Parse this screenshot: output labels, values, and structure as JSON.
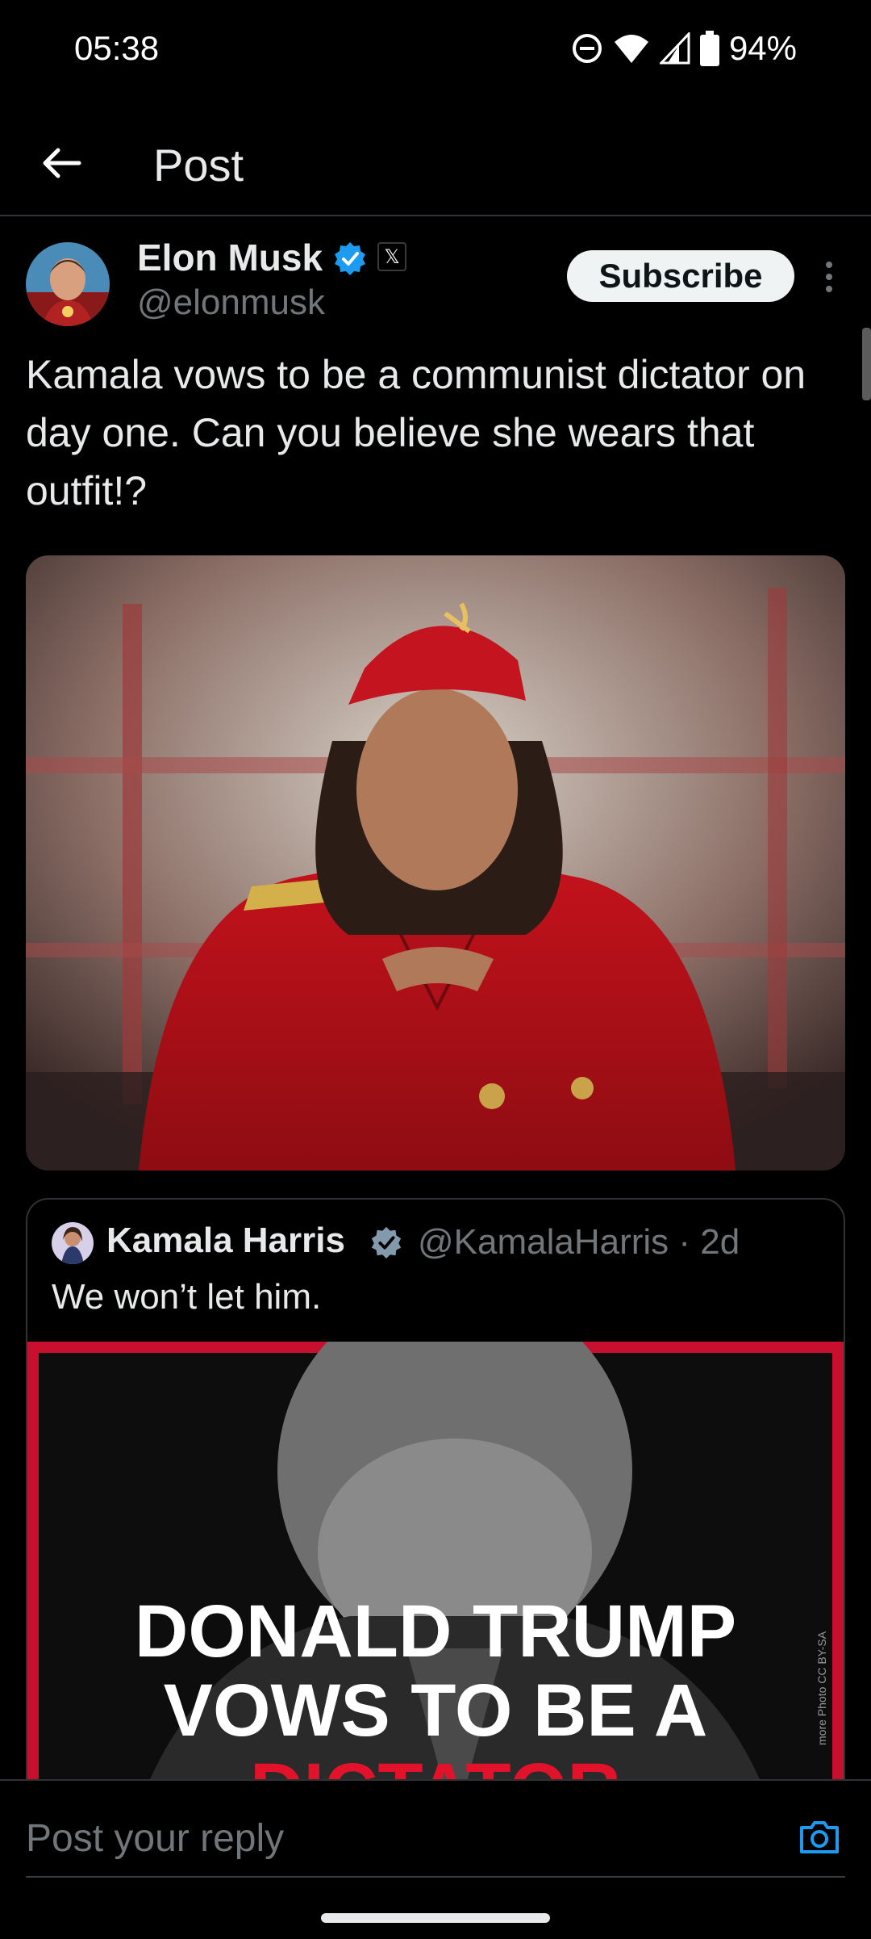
{
  "status_bar": {
    "time": "05:38",
    "battery": "94%",
    "icons": [
      "do-not-disturb-icon",
      "wifi-icon",
      "cell-signal-icon",
      "battery-icon"
    ]
  },
  "header": {
    "title": "Post",
    "back_icon": "arrow-left-icon"
  },
  "post": {
    "author_name": "Elon Musk",
    "author_handle": "@elonmusk",
    "affiliation_glyph": "𝕏",
    "subscribe_label": "Subscribe",
    "text": "Kamala vows to be a communist dictator on day one. Can you believe she wears that outfit!?"
  },
  "quote": {
    "author_name": "Kamala Harris",
    "meta": "@KamalaHarris · 2d",
    "text": "We won’t let him.",
    "image_headline_1": "DONALD TRUMP",
    "image_headline_2": "VOWS TO BE A",
    "image_headline_3": "DICTATOR",
    "image_credit": "more Photo CC BY-SA"
  },
  "reply": {
    "placeholder": "Post your reply"
  },
  "colors": {
    "accent": "#1d9bf0",
    "background": "#000000",
    "red": "#c8102e",
    "text": "#e7e9ea",
    "muted": "#71767b"
  }
}
